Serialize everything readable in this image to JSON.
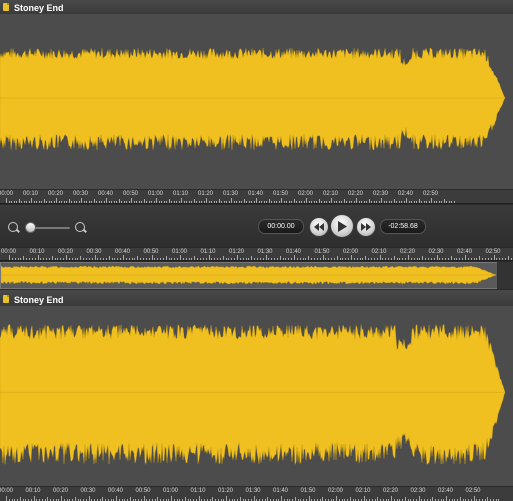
{
  "track": {
    "title": "Stoney End"
  },
  "colors": {
    "waveform": "#f0c020",
    "waveform_edge": "#c59a10",
    "background": "#4c4c4c",
    "ruler": "#3c3c3c"
  },
  "ruler_labels": [
    "00:00",
    "00:10",
    "00:20",
    "00:30",
    "00:40",
    "00:50",
    "01:00",
    "01:10",
    "01:20",
    "01:30",
    "01:40",
    "01:50",
    "02:00",
    "02:10",
    "02:20",
    "02:30",
    "02:40",
    "02:50"
  ],
  "transport": {
    "current_time": "00:00.00",
    "remaining_time": "-02:58.68",
    "rewind_icon": "rewind-icon",
    "play_icon": "play-icon",
    "fast_forward_icon": "fast-forward-icon"
  },
  "zoom": {
    "out_icon": "zoom-out-icon",
    "in_icon": "zoom-in-icon",
    "level": 0.0
  }
}
